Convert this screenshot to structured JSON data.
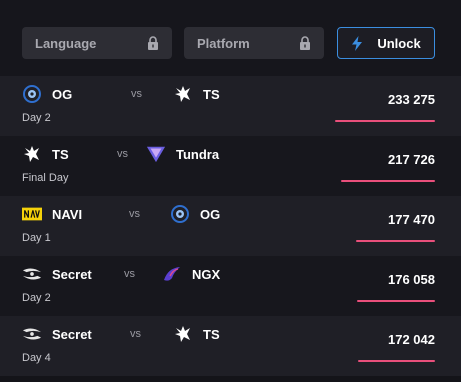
{
  "filters": {
    "language_label": "Language",
    "platform_label": "Platform",
    "unlock_label": "Unlock",
    "accent_color": "#3b8ee0"
  },
  "matches": [
    {
      "team1": "OG",
      "team1_logo": "og-logo",
      "vs": "vs",
      "team2": "TS",
      "team2_logo": "spirit-logo",
      "day": "Day 2",
      "viewers": "233 275",
      "viewers_value": 233275
    },
    {
      "team1": "TS",
      "team1_logo": "spirit-logo",
      "vs": "vs",
      "team2": "Tundra",
      "team2_logo": "tundra-logo",
      "day": "Final Day",
      "viewers": "217 726",
      "viewers_value": 217726
    },
    {
      "team1": "NAVI",
      "team1_logo": "navi-logo",
      "vs": "vs",
      "team2": "OG",
      "team2_logo": "og-logo",
      "day": "Day 1",
      "viewers": "177 470",
      "viewers_value": 177470
    },
    {
      "team1": "Secret",
      "team1_logo": "secret-logo",
      "vs": "vs",
      "team2": "NGX",
      "team2_logo": "ngx-logo",
      "day": "Day 2",
      "viewers": "176 058",
      "viewers_value": 176058
    },
    {
      "team1": "Secret",
      "team1_logo": "secret-logo",
      "vs": "vs",
      "team2": "TS",
      "team2_logo": "spirit-logo",
      "day": "Day 4",
      "viewers": "172 042",
      "viewers_value": 172042
    }
  ],
  "bar_color": "#e94f7b"
}
